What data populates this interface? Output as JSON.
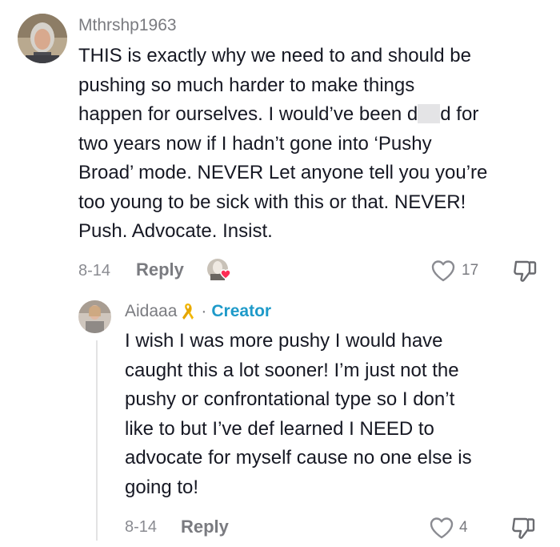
{
  "comment": {
    "username": "Mthrshp1963",
    "lines": [
      "THIS is exactly why we need to and should be",
      "pushing so much harder to make things",
      "happen for ourselves. I would’ve been d",
      "d for",
      "two years now if I hadn’t gone into ‘Pushy",
      "Broad’ mode. NEVER Let anyone tell you you’re",
      "too young to be sick with this or that. NEVER!",
      "Push. Advocate. Insist."
    ],
    "date": "8-14",
    "reply_label": "Reply",
    "like_count": "17"
  },
  "reply": {
    "username": "Aidaaa",
    "separator": "·",
    "badge": "Creator",
    "lines": [
      "I wish I was more pushy I would have",
      "caught this a lot sooner! I’m just not the",
      "pushy or confrontational type so I don’t",
      "like to but I’ve def learned I NEED to",
      "advocate for myself cause no one else is",
      "going to!"
    ],
    "date": "8-14",
    "reply_label": "Reply",
    "like_count": "4"
  },
  "icons": {
    "heart": "heart-outline-icon",
    "dislike": "thumbs-down-icon",
    "ribbon": "awareness-ribbon-icon",
    "creator_liked": "creator-liked-avatar-icon"
  },
  "colors": {
    "creator_badge": "#1e9ac9",
    "ribbon": "#f2b705",
    "liked_heart": "#fe2c55",
    "muted_text": "#7a7b80"
  }
}
